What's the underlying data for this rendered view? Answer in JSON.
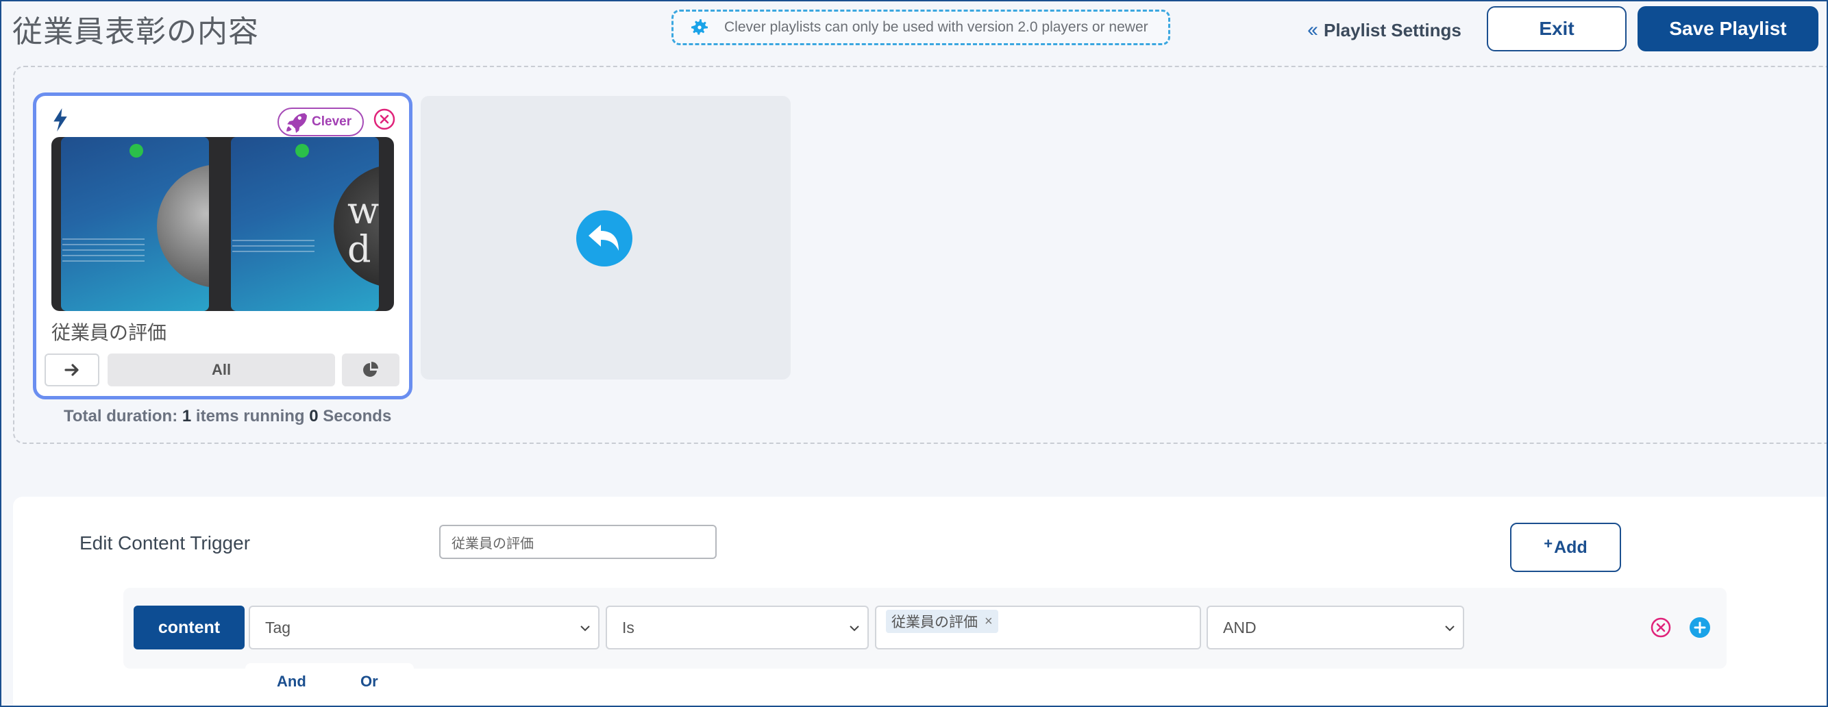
{
  "header": {
    "title": "従業員表彰の内容",
    "notice": "Clever playlists can only be used with version 2.0 players or newer",
    "notice_icon": "gear-icon",
    "playlist_settings_label": "Playlist Settings",
    "exit_label": "Exit",
    "save_label": "Save Playlist"
  },
  "playlist": {
    "items": [
      {
        "name": "従業員の評価",
        "badge": "Clever",
        "controls": {
          "schedule_label": "All"
        },
        "icons": [
          "bolt-icon",
          "rocket-icon",
          "close-circle-icon",
          "arrow-right-icon",
          "pie-chart-icon"
        ]
      }
    ],
    "drop_zone_icon": "undo-icon",
    "total_duration": {
      "prefix": "Total duration: ",
      "items_count": "1",
      "items_label": " items running ",
      "seconds": "0",
      "seconds_label": " Seconds"
    }
  },
  "trigger": {
    "title": "Edit Content Trigger",
    "name_value": "従業員の評価",
    "add_label": "Add",
    "rule": {
      "type_label": "content",
      "field": "Tag",
      "operator": "Is",
      "tags": [
        "従業員の評価"
      ],
      "conjunction": "AND"
    },
    "logic_options": [
      "And",
      "Or"
    ]
  },
  "colors": {
    "primary": "#0d4d93",
    "accent": "#1aa3e8",
    "clever": "#a23fb3",
    "danger": "#e0237a",
    "card_border": "#6a8ef0"
  }
}
